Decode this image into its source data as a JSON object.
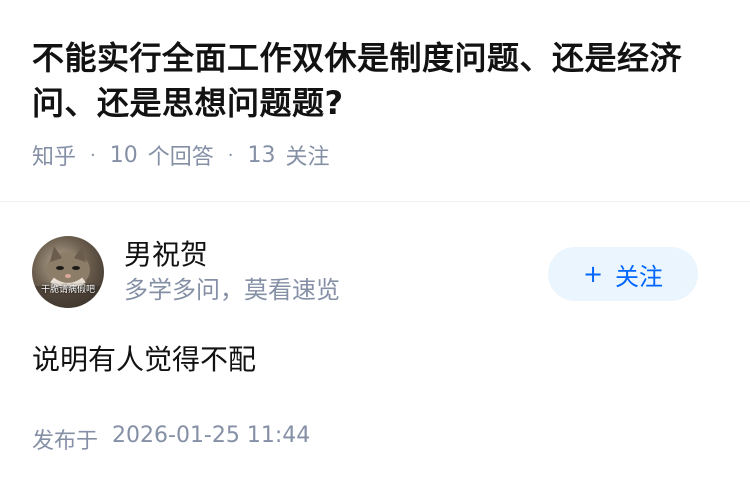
{
  "question": {
    "title": "不能实行全面工作双休是制度问题、还是经济问、还是思想问题题?",
    "source": "知乎",
    "answer_count": "10",
    "answer_label": "个回答",
    "follower_count": "13",
    "follower_label": "关注"
  },
  "author": {
    "name": "男祝贺",
    "headline": "多学多问，莫看速览",
    "avatar_caption": "干脆请病假吧",
    "follow_label": "关注",
    "follow_icon": "plus-icon"
  },
  "answer": {
    "content": "说明有人觉得不配",
    "publish_label": "发布于",
    "publish_time": "2026-01-25 11:44"
  },
  "colors": {
    "accent": "#0066ff",
    "follow_bg": "#ebf5fd",
    "meta": "#8590a6"
  }
}
